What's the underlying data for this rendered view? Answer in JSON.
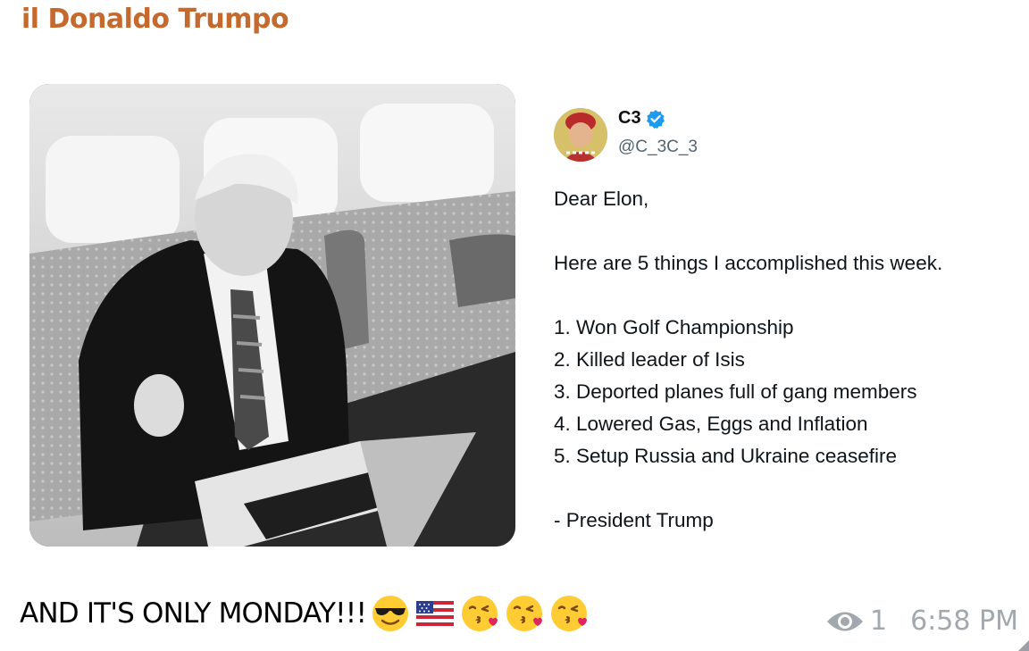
{
  "message": {
    "sender_name": "il Donaldo Trumpo",
    "sender_color": "#c56a2c",
    "caption_text": "AND IT'S ONLY MONDAY!!!",
    "caption_emojis": [
      "smiling-face-with-sunglasses",
      "flag-united-states",
      "face-blowing-kiss",
      "face-blowing-kiss",
      "face-blowing-kiss"
    ],
    "views": "1",
    "time": "6:58 PM",
    "views_icon": "eye-icon"
  },
  "photo": {
    "description_icon": "photo"
  },
  "tweet": {
    "display_name": "C3",
    "handle": "@C_3C_3",
    "verified": true,
    "verified_color": "#1d9bf0",
    "lines": [
      "Dear Elon,",
      "",
      "Here are 5 things I accomplished this week.",
      "",
      "1. Won Golf Championship",
      "2. Killed leader of Isis",
      "3. Deported planes full of gang members",
      "4. Lowered Gas, Eggs and Inflation",
      "5. Setup Russia and Ukraine ceasefire",
      "",
      "- President Trump"
    ]
  }
}
